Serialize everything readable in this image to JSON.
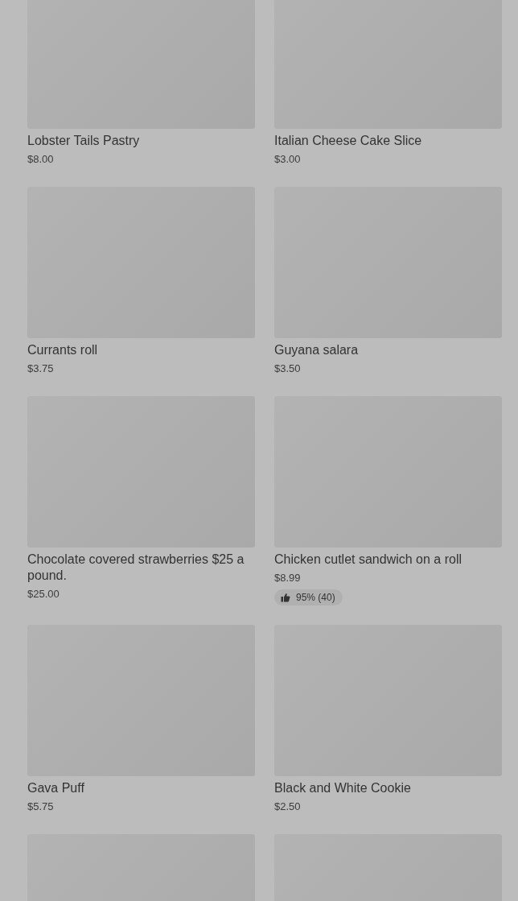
{
  "products": [
    {
      "image": {
        "kind": "picture"
      },
      "name": "Lobster Tails Pastry",
      "price": "$8.00"
    },
    {
      "image": {
        "kind": "picture"
      },
      "name": "Italian Cheese Cake Slice",
      "price": "$3.00"
    },
    {
      "image": {
        "kind": "picture"
      },
      "name": "Currants roll",
      "price": "$3.75"
    },
    {
      "image": {
        "kind": "picture"
      },
      "name": "Guyana salara",
      "price": "$3.50"
    },
    {
      "image": {
        "kind": "picture"
      },
      "name": "Chocolate covered strawberries  $25 a pound.",
      "price": "$25.00"
    },
    {
      "image": {
        "kind": "picture"
      },
      "name": "Chicken cutlet sandwich on a roll",
      "price": "$8.99",
      "rating": "95% (40)"
    },
    {
      "image": {
        "kind": "picture"
      },
      "name": "Gava Puff",
      "price": "$5.75"
    },
    {
      "image": {
        "kind": "picture"
      },
      "name": "Black and White Cookie",
      "price": "$2.50"
    },
    {
      "image": {
        "kind": "picture"
      }
    },
    {
      "image": {
        "kind": "picture"
      }
    }
  ]
}
